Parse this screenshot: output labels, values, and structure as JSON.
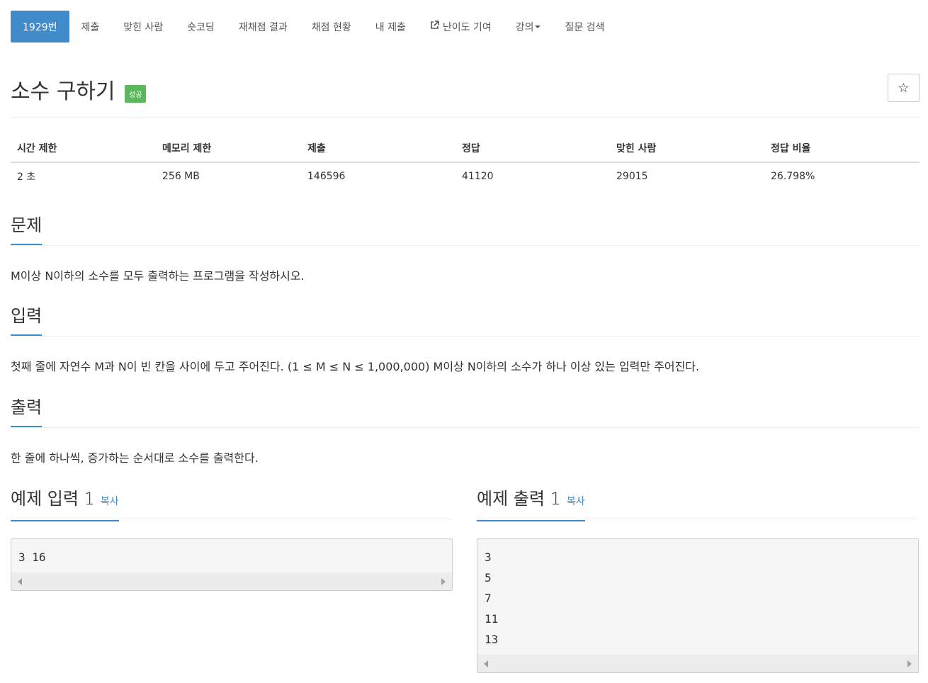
{
  "nav": {
    "items": [
      {
        "label": "1929번",
        "active": true
      },
      {
        "label": "제출"
      },
      {
        "label": "맞힌 사람"
      },
      {
        "label": "숏코딩"
      },
      {
        "label": "재채점 결과"
      },
      {
        "label": "채점 현황"
      },
      {
        "label": "내 제출"
      },
      {
        "label": "난이도 기여",
        "icon": "external-link-icon"
      },
      {
        "label": "강의",
        "icon": "caret-down-icon"
      },
      {
        "label": "질문 검색"
      }
    ]
  },
  "problem": {
    "title": "소수 구하기",
    "status_badge": "성공",
    "star_glyph": "☆"
  },
  "stats": {
    "headers": [
      "시간 제한",
      "메모리 제한",
      "제출",
      "정답",
      "맞힌 사람",
      "정답 비율"
    ],
    "values": [
      "2 초",
      "256 MB",
      "146596",
      "41120",
      "29015",
      "26.798%"
    ]
  },
  "sections": {
    "description": {
      "heading": "문제",
      "text": "M이상 N이하의 소수를 모두 출력하는 프로그램을 작성하시오."
    },
    "input": {
      "heading": "입력",
      "text": "첫째 줄에 자연수 M과 N이 빈 칸을 사이에 두고 주어진다. (1 ≤ M ≤ N ≤ 1,000,000) M이상 N이하의 소수가 하나 이상 있는 입력만 주어진다."
    },
    "output": {
      "heading": "출력",
      "text": "한 줄에 하나씩, 증가하는 순서대로 소수를 출력한다."
    }
  },
  "samples": {
    "input": {
      "heading": "예제 입력 1",
      "copy_label": "복사",
      "content": "3 16"
    },
    "output": {
      "heading": "예제 출력 1",
      "copy_label": "복사",
      "content": "3\n5\n7\n11\n13"
    }
  },
  "colors": {
    "accent": "#428bca",
    "success": "#5cb85c"
  }
}
